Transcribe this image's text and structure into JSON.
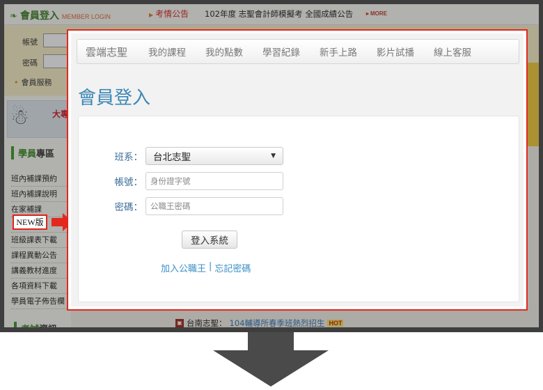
{
  "background": {
    "member_title": "會員登入",
    "member_title_en": "MEMBER LOGIN",
    "news_label": "考情公告",
    "news_text": "102年度 志聖會計師模擬考 全國成績公告",
    "more_label": "MORE",
    "account_label": "帳號",
    "password_label": "密碼",
    "member_service": "會員服務",
    "banner_text": "大專",
    "student_section": {
      "highlight": "學員",
      "rest": "專區"
    },
    "left_items": [
      "班內補課預約",
      "班內補課說明",
      "在家補課",
      "",
      "班級課表下載",
      "課程異動公告",
      "講義教材進度",
      "各項資料下載",
      "學員電子佈告欄"
    ],
    "new_badge": "NEW版",
    "bottom_news": {
      "prefix": "台南志聖：",
      "link": "104輔導所春季班熱烈招生",
      "hot": "HOT"
    },
    "exam_section": {
      "highlight": "考試",
      "rest": "資訊"
    }
  },
  "nav": {
    "brand": "雲端志聖",
    "items": [
      "我的課程",
      "我的點數",
      "學習紀錄",
      "新手上路",
      "影片試播",
      "線上客服"
    ]
  },
  "login": {
    "title": "會員登入",
    "class_label": "班系：",
    "class_value": "台北志聖",
    "account_label": "帳號：",
    "account_placeholder": "身份證字號",
    "password_label": "密碼：",
    "password_placeholder": "公職王密碼",
    "submit_label": "登入系統",
    "join_link": "加入公職王",
    "separator": "|",
    "forgot_link": "忘記密碼"
  },
  "colors": {
    "accent_red": "#e3281e",
    "title_blue": "#3a87b5",
    "link_blue": "#3a8fc7",
    "arrow_gray": "#4a4a4a"
  }
}
